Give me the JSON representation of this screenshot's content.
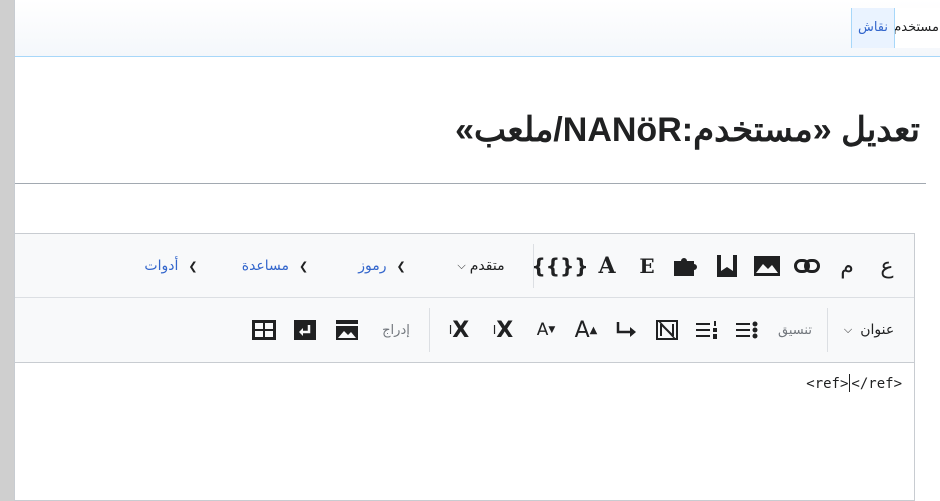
{
  "tabs": {
    "user": "مستخدم",
    "talk": "نقاش"
  },
  "page": {
    "title": "تعديل «مستخدم:NANöR/ملعب»"
  },
  "toolbar_top": {
    "bold": "ع",
    "italic": "م",
    "advanced": "متقدم",
    "special_chars": "رموز",
    "help": "مساعدة",
    "tools": "أدوات",
    "templates": "{{}}"
  },
  "toolbar_bottom": {
    "heading": "عنوان",
    "format": "تنسيق",
    "insert": "إدراج"
  },
  "textarea": {
    "before_caret": "<ref>",
    "after_caret": "</ref>"
  },
  "colors": {
    "link": "#3366cc",
    "text": "#202122",
    "toolbar_bg": "#f8f9fa"
  }
}
